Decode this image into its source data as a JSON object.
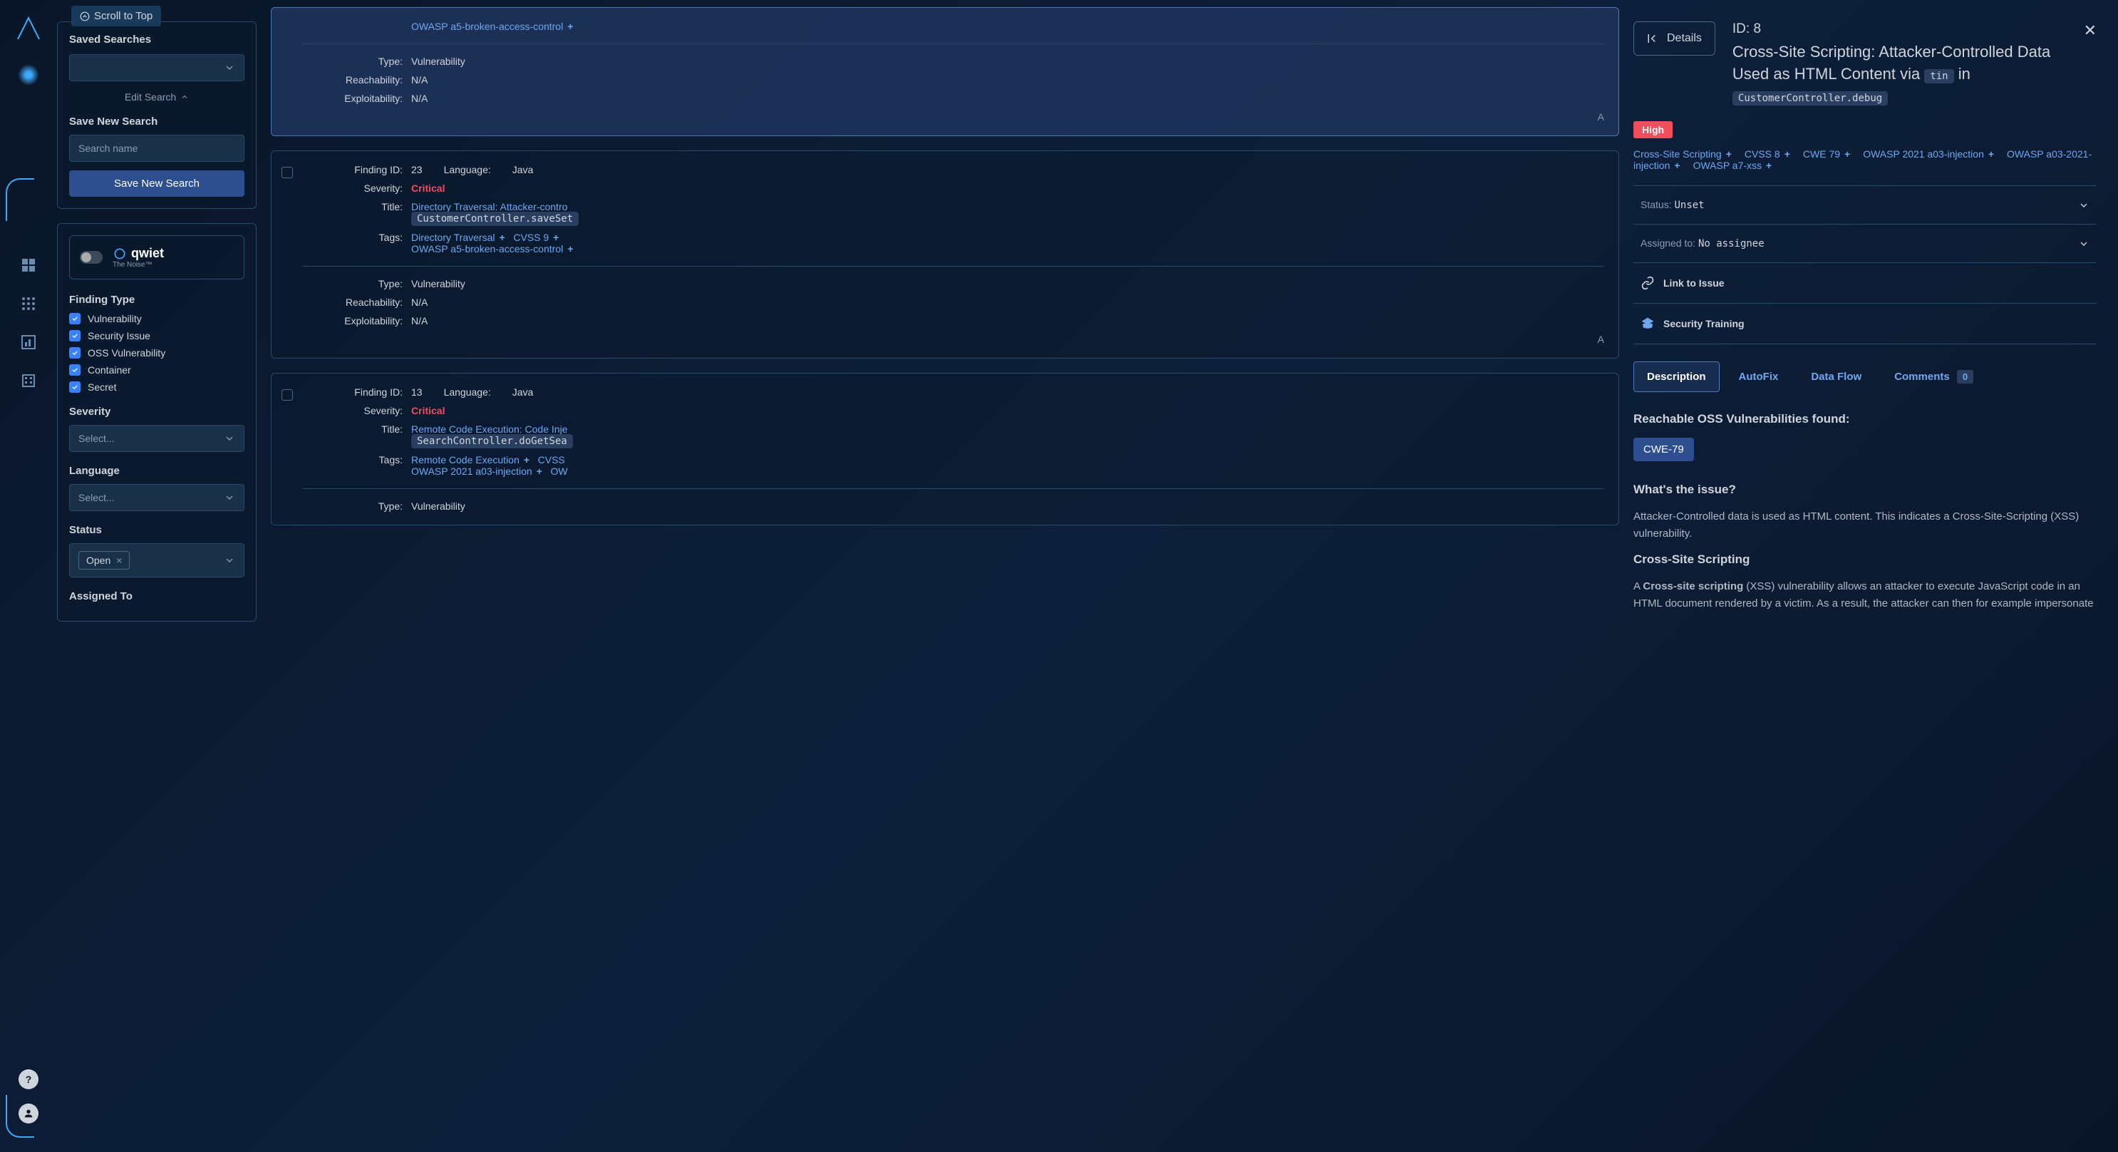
{
  "scroll_top": "Scroll to Top",
  "sidebar": {
    "saved_searches": "Saved Searches",
    "edit_search": "Edit Search",
    "save_new_search": "Save New Search",
    "search_name_placeholder": "Search name",
    "save_btn": "Save New Search",
    "qwiet_name": "qwiet",
    "qwiet_sub": "The Noise™",
    "finding_type_label": "Finding Type",
    "finding_types": [
      "Vulnerability",
      "Security Issue",
      "OSS Vulnerability",
      "Container",
      "Secret"
    ],
    "severity_label": "Severity",
    "severity_placeholder": "Select...",
    "language_label": "Language",
    "language_placeholder": "Select...",
    "status_label": "Status",
    "status_value": "Open",
    "assigned_to_label": "Assigned To"
  },
  "findings": [
    {
      "tags_tail": "OWASP a5-broken-access-control",
      "type_label": "Type:",
      "type_value": "Vulnerability",
      "reach_label": "Reachability:",
      "reach_value": "N/A",
      "exploit_label": "Exploitability:",
      "exploit_value": "N/A"
    },
    {
      "id_label": "Finding ID:",
      "id_value": "23",
      "lang_label": "Language:",
      "lang_value": "Java",
      "sev_label": "Severity:",
      "sev_value": "Critical",
      "title_label": "Title:",
      "title_value": "Directory Traversal: Attacker-contro",
      "title_code": "CustomerController.saveSet",
      "tags_label": "Tags:",
      "tags": [
        "Directory Traversal",
        "CVSS 9",
        "OWASP a5-broken-access-control"
      ],
      "type_label": "Type:",
      "type_value": "Vulnerability",
      "reach_label": "Reachability:",
      "reach_value": "N/A",
      "exploit_label": "Exploitability:",
      "exploit_value": "N/A"
    },
    {
      "id_label": "Finding ID:",
      "id_value": "13",
      "lang_label": "Language:",
      "lang_value": "Java",
      "sev_label": "Severity:",
      "sev_value": "Critical",
      "title_label": "Title:",
      "title_value": "Remote Code Execution: Code Inje",
      "title_code": "SearchController.doGetSea",
      "tags_label": "Tags:",
      "tags": [
        "Remote Code Execution",
        "CVSS",
        "OWASP 2021 a03-injection",
        "OW"
      ],
      "type_label": "Type:",
      "type_value": "Vulnerability"
    }
  ],
  "details": {
    "back_btn": "Details",
    "id_label": "ID: ",
    "id_value": "8",
    "title_pre": "Cross-Site Scripting: Attacker-Controlled Data Used as HTML Content via ",
    "title_code1": "tin",
    "title_mid": " in ",
    "title_code2": "CustomerController.debug",
    "severity": "High",
    "tags": [
      "Cross-Site Scripting",
      "CVSS 8",
      "CWE 79",
      "OWASP 2021 a03-injection",
      "OWASP a03-2021-injection",
      "OWASP a7-xss"
    ],
    "status_label": "Status: ",
    "status_value": "Unset",
    "assigned_label": "Assigned to: ",
    "assigned_value": "No assignee",
    "link_issue": "Link to Issue",
    "security_training": "Security Training",
    "tabs": {
      "description": "Description",
      "autofix": "AutoFix",
      "dataflow": "Data Flow",
      "comments": "Comments",
      "comments_count": "0"
    },
    "reachable_h": "Reachable OSS Vulnerabilities found:",
    "cwe_badge": "CWE-79",
    "issue_h": "What's the issue?",
    "issue_body": "Attacker-Controlled data is used as HTML content. This indicates a Cross-Site-Scripting (XSS) vulnerability.",
    "xss_h": "Cross-Site Scripting",
    "xss_body_pre": "A ",
    "xss_body_bold": "Cross-site scripting",
    "xss_body_post": " (XSS) vulnerability allows an attacker to execute JavaScript code in an HTML document rendered by a victim. As a result, the attacker can then for example impersonate"
  }
}
